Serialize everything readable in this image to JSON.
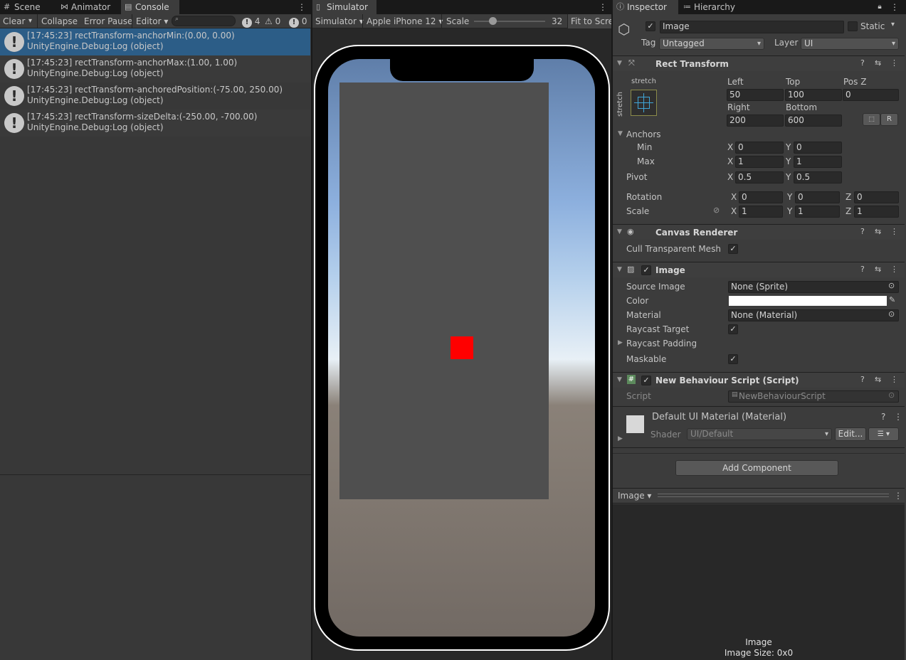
{
  "left_tabs": [
    {
      "label": "Scene",
      "icon": "hash-icon"
    },
    {
      "label": "Animator",
      "icon": "animator-icon"
    },
    {
      "label": "Console",
      "icon": "console-icon"
    }
  ],
  "console": {
    "toolbar": {
      "clear": "Clear",
      "collapse": "Collapse",
      "error_pause": "Error Pause",
      "editor": "Editor",
      "search_placeholder": "",
      "count_logs": "4",
      "count_warnings": "0",
      "count_errors": "0"
    },
    "entries": [
      {
        "line1": "[17:45:23] rectTransform-anchorMin:(0.00, 0.00)",
        "line2": "UnityEngine.Debug:Log (object)"
      },
      {
        "line1": "[17:45:23] rectTransform-anchorMax:(1.00, 1.00)",
        "line2": "UnityEngine.Debug:Log (object)"
      },
      {
        "line1": "[17:45:23] rectTransform-anchoredPosition:(-75.00, 250.00)",
        "line2": "UnityEngine.Debug:Log (object)"
      },
      {
        "line1": "[17:45:23] rectTransform-sizeDelta:(-250.00, -700.00)",
        "line2": "UnityEngine.Debug:Log (object)"
      }
    ]
  },
  "simulator": {
    "tab": "Simulator",
    "mode": "Simulator",
    "device": "Apple iPhone 12",
    "scale_label": "Scale",
    "scale_value": "32",
    "fit": "Fit to Scre"
  },
  "inspector": {
    "tab": "Inspector",
    "hierarchy_tab": "Hierarchy",
    "object_name": "Image",
    "static_label": "Static",
    "tag_label": "Tag",
    "tag_value": "Untagged",
    "layer_label": "Layer",
    "layer_value": "UI",
    "rect_transform": {
      "title": "Rect Transform",
      "stretch_h": "stretch",
      "stretch_v": "stretch",
      "left_label": "Left",
      "left": "50",
      "top_label": "Top",
      "top": "100",
      "posz_label": "Pos Z",
      "posz": "0",
      "right_label": "Right",
      "right": "200",
      "bottom_label": "Bottom",
      "bottom": "600",
      "r_button": "R",
      "anchors_label": "Anchors",
      "min_label": "Min",
      "min_x": "0",
      "min_y": "0",
      "max_label": "Max",
      "max_x": "1",
      "max_y": "1",
      "pivot_label": "Pivot",
      "pivot_x": "0.5",
      "pivot_y": "0.5",
      "rotation_label": "Rotation",
      "rot_x": "0",
      "rot_y": "0",
      "rot_z": "0",
      "scale_label": "Scale",
      "scale_x": "1",
      "scale_y": "1",
      "scale_z": "1",
      "x": "X",
      "y": "Y",
      "z": "Z"
    },
    "canvas_renderer": {
      "title": "Canvas Renderer",
      "cull_label": "Cull Transparent Mesh"
    },
    "image": {
      "title": "Image",
      "source_label": "Source Image",
      "source_value": "None (Sprite)",
      "color_label": "Color",
      "material_label": "Material",
      "material_value": "None (Material)",
      "raycast_target_label": "Raycast Target",
      "raycast_padding_label": "Raycast Padding",
      "maskable_label": "Maskable"
    },
    "script": {
      "title": "New Behaviour Script (Script)",
      "script_label": "Script",
      "script_value": "NewBehaviourScript"
    },
    "material": {
      "title": "Default UI Material (Material)",
      "shader_label": "Shader",
      "shader_value": "UI/Default",
      "edit_button": "Edit..."
    },
    "add_component": "Add Component",
    "preview": {
      "dropdown": "Image",
      "caption1": "Image",
      "caption2": "Image Size: 0x0"
    }
  },
  "colors": {
    "selected_row": "#2c5d87",
    "red_square": "#ff0000",
    "panel_grey": "#4f4f4f"
  }
}
